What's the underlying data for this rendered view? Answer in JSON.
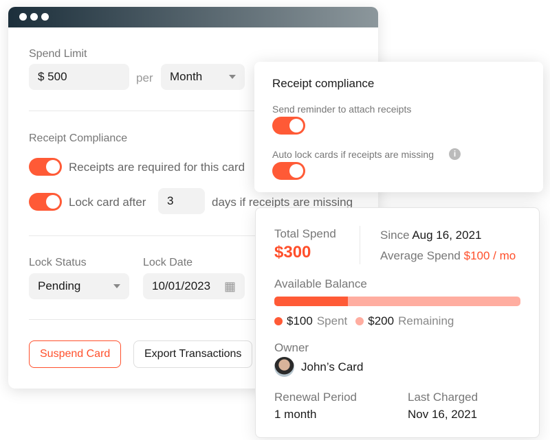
{
  "window": {
    "controls": [
      "close",
      "minimize",
      "maximize"
    ]
  },
  "spend_limit": {
    "label": "Spend Limit",
    "amount": "$ 500",
    "per": "per",
    "period": "Month"
  },
  "receipt_compliance": {
    "heading": "Receipt Compliance",
    "required_label": "Receipts are required for this card",
    "required_on": true,
    "lock_on": true,
    "lock_prefix": "Lock card after",
    "lock_days": "3",
    "lock_suffix": "days if receipts are missing"
  },
  "lock": {
    "status_label": "Lock Status",
    "status_value": "Pending",
    "date_label": "Lock Date",
    "date_value": "10/01/2023"
  },
  "actions": {
    "suspend": "Suspend Card",
    "export": "Export Transactions"
  },
  "popup": {
    "title": "Receipt compliance",
    "reminder_label": "Send reminder to attach receipts",
    "reminder_on": true,
    "autolock_label": "Auto lock cards if receipts are missing",
    "autolock_on": true
  },
  "summary": {
    "total_label": "Total Spend",
    "total_value": "$300",
    "since_label": "Since",
    "since_value": "Aug 16, 2021",
    "avg_label": "Average Spend",
    "avg_value": "$100 / mo",
    "balance_label": "Available Balance",
    "spent_fraction": 0.3,
    "spent_value": "$100",
    "spent_label": "Spent",
    "remaining_value": "$200",
    "remaining_label": "Remaining",
    "owner_label": "Owner",
    "owner_value": "John’s Card",
    "renewal_label": "Renewal Period",
    "renewal_value": "1 month",
    "charged_label": "Last Charged",
    "charged_value": "Nov 16, 2021"
  },
  "colors": {
    "accent": "#ff5a36",
    "accent_light": "#ffada0"
  }
}
